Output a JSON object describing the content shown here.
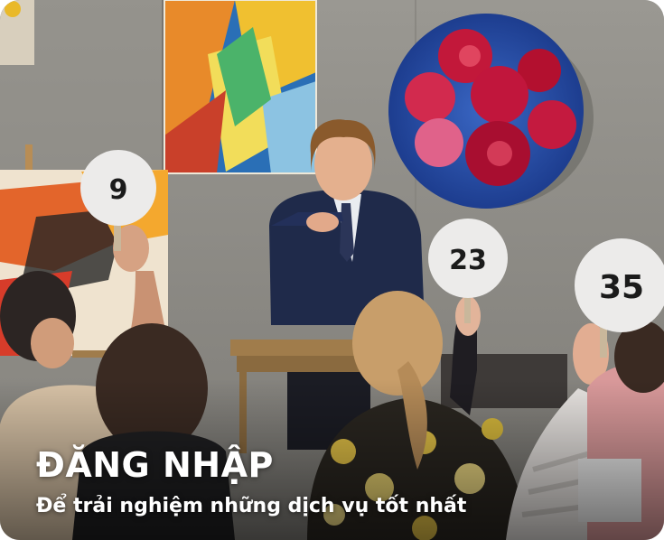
{
  "hero": {
    "title": "ĐĂNG NHẬP",
    "subtitle": "Để trải nghiệm những dịch vụ tốt nhất"
  },
  "photo": {
    "paddles": [
      "9",
      "23",
      "35"
    ]
  }
}
